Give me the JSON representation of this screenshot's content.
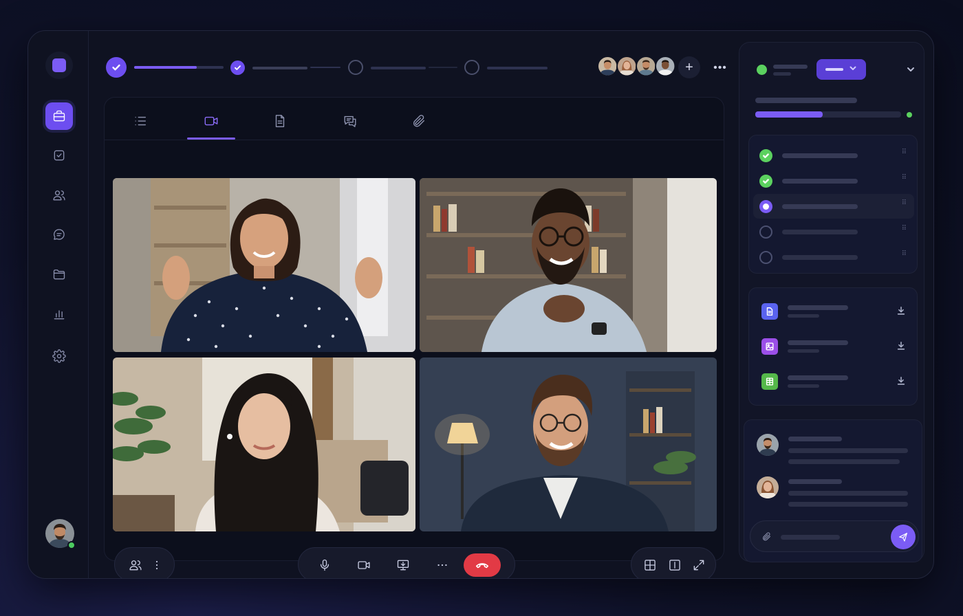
{
  "sidebar": {
    "items": [
      {
        "icon": "briefcase-icon",
        "active": true
      },
      {
        "icon": "checkbox-icon",
        "active": false
      },
      {
        "icon": "users-icon",
        "active": false
      },
      {
        "icon": "chat-icon",
        "active": false
      },
      {
        "icon": "folder-icon",
        "active": false
      },
      {
        "icon": "bar-chart-icon",
        "active": false
      },
      {
        "icon": "gear-icon",
        "active": false
      }
    ],
    "user_status": "online"
  },
  "stepper": {
    "steps": [
      {
        "state": "done",
        "progress": 0.7
      },
      {
        "state": "done",
        "progress": 0.5
      },
      {
        "state": "todo",
        "progress": 0
      },
      {
        "state": "todo",
        "progress": 0
      }
    ]
  },
  "participants": {
    "count_shown": 4,
    "add_icon": "plus-icon",
    "more_icon": "ellipsis-icon"
  },
  "tabs": [
    {
      "icon": "list-icon",
      "active": false
    },
    {
      "icon": "video-icon",
      "active": true
    },
    {
      "icon": "document-icon",
      "active": false
    },
    {
      "icon": "chat-bubbles-icon",
      "active": false
    },
    {
      "icon": "paperclip-icon",
      "active": false
    }
  ],
  "video_grid": {
    "tiles": [
      {
        "participant": "woman-polka-dot-shirt",
        "bg": "#b9b3a9"
      },
      {
        "participant": "man-glasses-headset",
        "bg": "#8d8275"
      },
      {
        "participant": "woman-long-hair",
        "bg": "#c7b8a2"
      },
      {
        "participant": "man-glasses-beard",
        "bg": "#3a4457"
      }
    ]
  },
  "controls": {
    "left": [
      "participants-icon",
      "kebab-icon"
    ],
    "center": [
      "microphone-icon",
      "camera-icon",
      "screen-share-icon",
      "more-icon",
      "end-call-icon"
    ],
    "right": [
      "grid-layout-icon",
      "split-layout-icon",
      "fullscreen-icon"
    ]
  },
  "right_panel": {
    "status_color": "#5bd15f",
    "progress": 0.46,
    "tasks": [
      {
        "state": "done"
      },
      {
        "state": "done"
      },
      {
        "state": "current"
      },
      {
        "state": "todo"
      },
      {
        "state": "todo"
      }
    ],
    "files": [
      {
        "icon": "file-icon",
        "color": "#5a63f0"
      },
      {
        "icon": "image-icon",
        "color": "#9b4fe8"
      },
      {
        "icon": "table-icon",
        "color": "#55b84a"
      }
    ]
  },
  "colors": {
    "accent": "#7b5cf5",
    "success": "#5bd15f",
    "danger": "#e23a45"
  }
}
